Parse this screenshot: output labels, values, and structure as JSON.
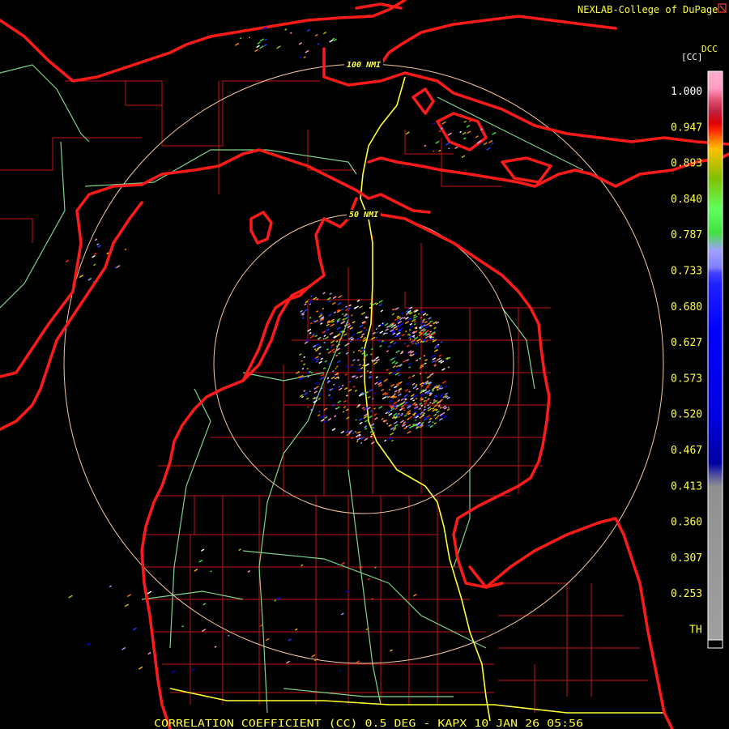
{
  "header": {
    "credit": "NEXLAB-College of DuPage",
    "credit_icon": "resize-corner-icon"
  },
  "legend": {
    "unit_top": "DCC",
    "unit": "[CC]",
    "labels": [
      "1.000",
      "0.947",
      "0.893",
      "0.840",
      "0.787",
      "0.733",
      "0.680",
      "0.627",
      "0.573",
      "0.520",
      "0.467",
      "0.413",
      "0.360",
      "0.307",
      "0.253",
      "TH"
    ]
  },
  "rings": {
    "inner_label": "50 NMI",
    "outer_label": "100 NMI"
  },
  "footer": {
    "caption": "CORRELATION COEFFICIENT (CC) 0.5 DEG - KAPX 10 JAN 26 05:56"
  }
}
